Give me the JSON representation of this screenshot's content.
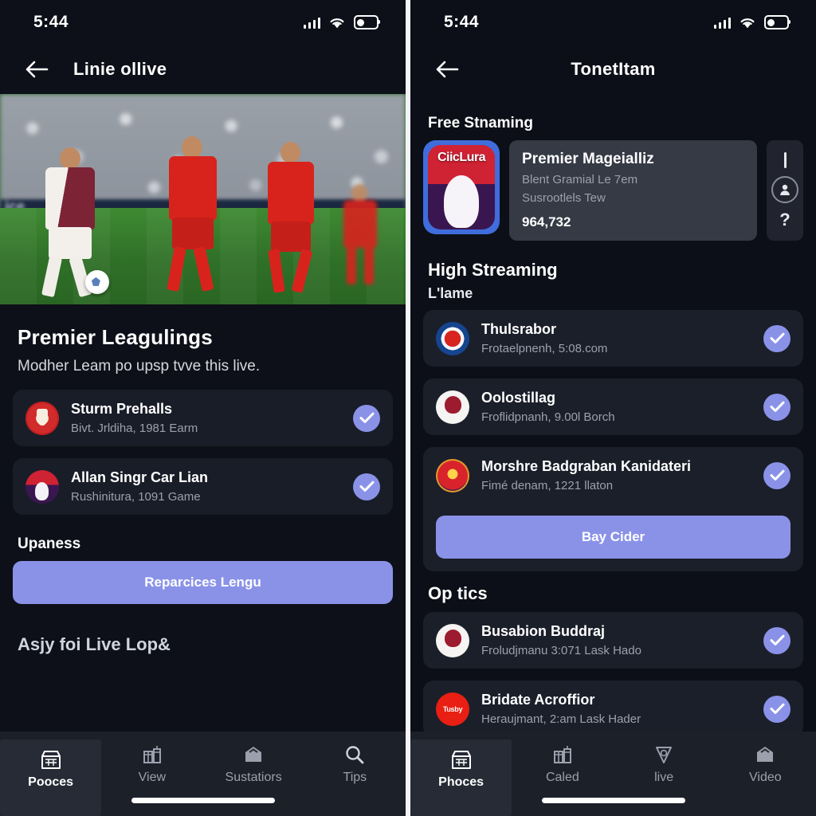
{
  "left": {
    "status": {
      "time": "5:44",
      "signal_icon": "cellular-signal-icon",
      "wifi_icon": "wifi-icon",
      "battery_icon": "battery-icon"
    },
    "nav": {
      "back_icon": "back-arrow-icon",
      "title": "Linie ollive"
    },
    "hero": {
      "name": "football-match-photo",
      "adboard_text": "ice"
    },
    "headline": "Premier Leagulings",
    "subhead": "Modher Leam po upsp tvve this live.",
    "rows": [
      {
        "title": "Sturm Prehalls",
        "subtitle": "Bivt. Jrldiha, 1981 Earm",
        "crest": "manchester-united-crest",
        "checked": true
      },
      {
        "title": "Allan Singr Car Lian",
        "subtitle": "Rushinitura, 1091 Game",
        "crest": "ciiclura-crest",
        "checked": true
      }
    ],
    "section_updates": "Upaness",
    "cta_label": "Reparcices Lengu",
    "section_live": "Asjy foi Live Lop&",
    "tabs": [
      {
        "label": "Pooces",
        "icon": "store-icon",
        "active": true
      },
      {
        "label": "View",
        "icon": "gifts-icon",
        "active": false
      },
      {
        "label": "Sustatiors",
        "icon": "home-icon",
        "active": false
      },
      {
        "label": "Tips",
        "icon": "search-icon",
        "active": false
      }
    ]
  },
  "right": {
    "status": {
      "time": "5:44",
      "signal_icon": "cellular-signal-icon",
      "wifi_icon": "wifi-icon",
      "battery_icon": "battery-icon"
    },
    "nav": {
      "back_icon": "back-arrow-icon",
      "title": "TonetItam"
    },
    "section_free": "Free Stnaming",
    "featured": {
      "app_icon_label": "CiicLura",
      "title": "Premier Mageialliz",
      "line1": "Blent Gramial Le 7em",
      "line2": "Susrootlels Tew",
      "number": "964,732",
      "rail": {
        "bar_icon": "menu-bar-icon",
        "person_icon": "person-icon",
        "help_label": "?"
      }
    },
    "section_high": "High Streaming",
    "section_high_sub": "L'lame",
    "rows_high": [
      {
        "title": "Thulsrabor",
        "subtitle": "Frotaelpnenh, 5:08.com",
        "crest": "blue-club-crest",
        "checked": true
      },
      {
        "title": "Oolostillag",
        "subtitle": "Froflidpnanh, 9.00l Borch",
        "crest": "white-club-crest",
        "checked": true
      },
      {
        "title": "Morshre Badgraban Kanidateri",
        "subtitle": "Fimé denam, 1221 llaton",
        "crest": "shield-crest",
        "checked": true
      }
    ],
    "cta_label": "Bay Cider",
    "section_optics": "Op tics",
    "rows_optics": [
      {
        "title": "Busabion Buddraj",
        "subtitle": "Froludjmanu 3:071 Lask Hado",
        "crest": "white-eagle-crest",
        "checked": true
      },
      {
        "title": "Bridate Acroffior",
        "subtitle": "Heraujmant, 2:am Lask Hader",
        "crest": "red-brand-crest",
        "crest_text": "Tusby",
        "checked": true
      }
    ],
    "tabs": [
      {
        "label": "Phoces",
        "icon": "store-icon",
        "active": true
      },
      {
        "label": "Caled",
        "icon": "gifts-icon",
        "active": false
      },
      {
        "label": "live",
        "icon": "shield-icon",
        "active": false
      },
      {
        "label": "Video",
        "icon": "home-icon",
        "active": false
      }
    ]
  },
  "colors": {
    "accent": "#8a92e8",
    "panel_bg": "#0d1018",
    "card_bg": "#191d28",
    "divider": "#f2f4f8"
  }
}
